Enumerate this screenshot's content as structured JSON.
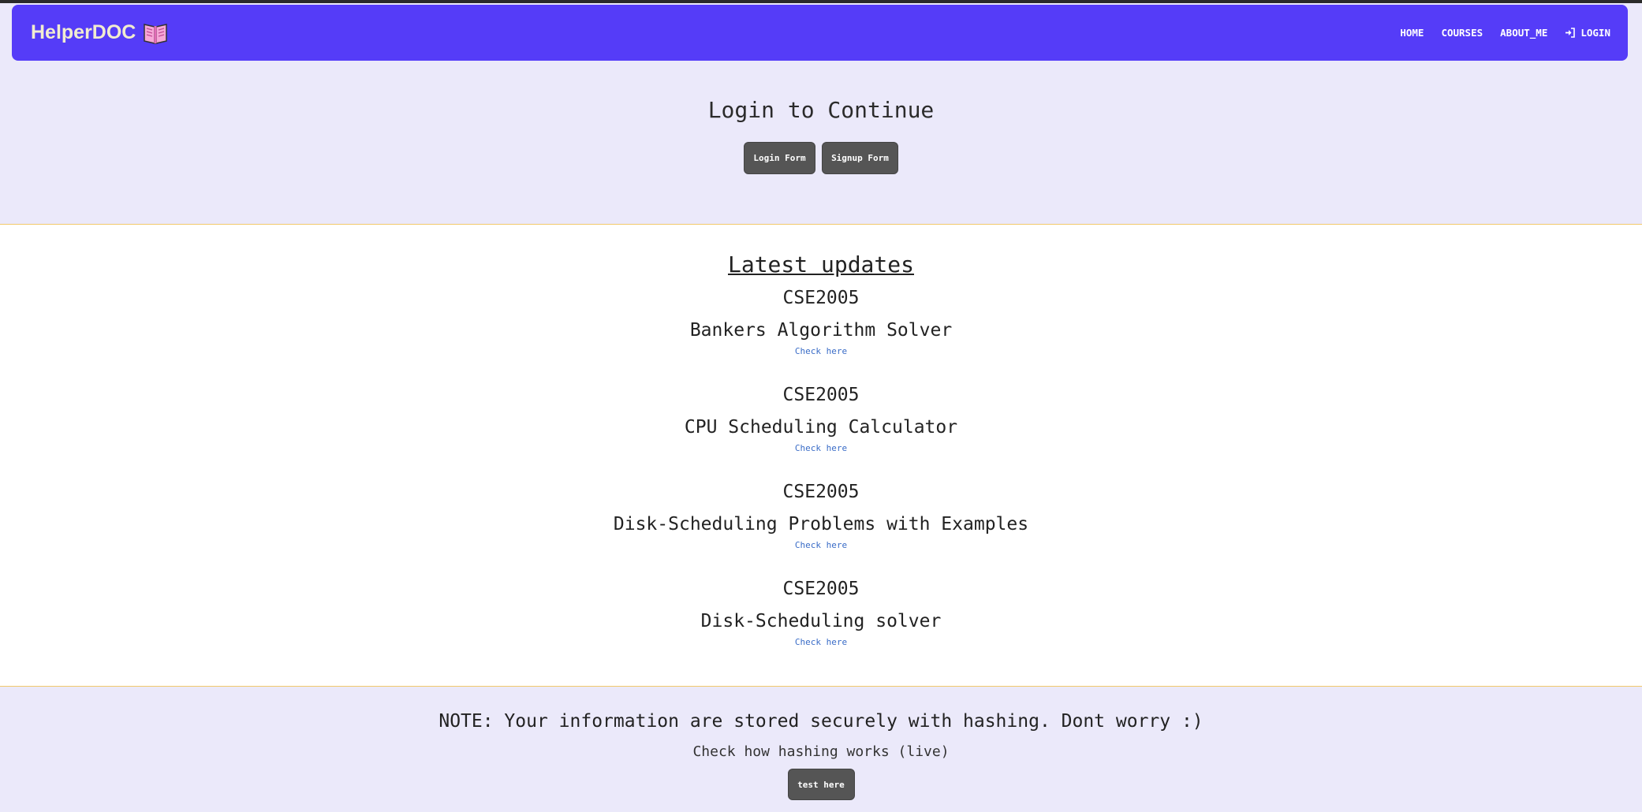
{
  "navbar": {
    "brand": "HelperDOC",
    "brand_icon": "book-icon",
    "links": [
      {
        "label": "HOME"
      },
      {
        "label": "COURSES"
      },
      {
        "label": "ABOUT_ME"
      },
      {
        "label": "LOGIN",
        "icon": "login-icon"
      }
    ],
    "background": "#553cf8",
    "brand_color": "#f1ecd0"
  },
  "hero": {
    "title": "Login to Continue",
    "login_button": "Login Form",
    "signup_button": "Signup Form"
  },
  "updates": {
    "title": "Latest updates",
    "items": [
      {
        "code": "CSE2005",
        "name": "Bankers Algorithm Solver",
        "link": "Check here"
      },
      {
        "code": "CSE2005",
        "name": "CPU Scheduling Calculator",
        "link": "Check here"
      },
      {
        "code": "CSE2005",
        "name": "Disk-Scheduling Problems with Examples",
        "link": "Check here"
      },
      {
        "code": "CSE2005",
        "name": "Disk-Scheduling solver",
        "link": "Check here"
      }
    ]
  },
  "note": {
    "text": "NOTE: Your information are stored securely with hashing. Dont worry :)",
    "subtext": "Check how hashing works (live)",
    "button": "test here"
  },
  "colors": {
    "page_background": "#ebe9fa",
    "button_background": "#555555",
    "link_color": "#3a6cc7",
    "section_border": "#f2c96b"
  }
}
